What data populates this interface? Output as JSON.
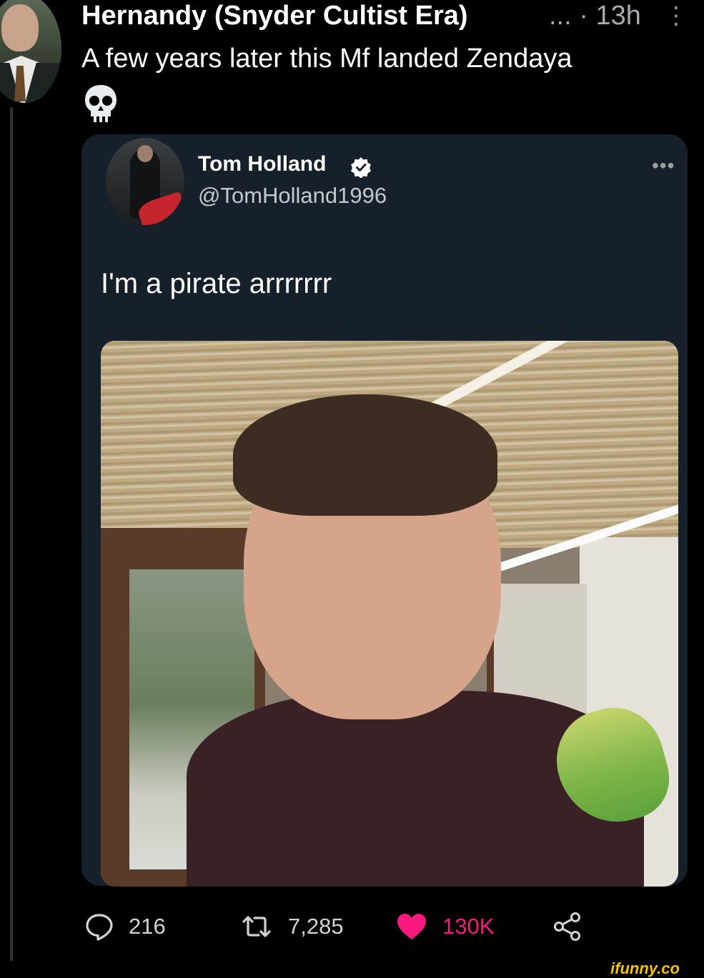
{
  "tweet": {
    "display_name": "Hernandy (Snyder Cultist Era)",
    "meta": "... · 13h",
    "menu_glyph": "⋮",
    "text": "A few years later this Mf landed Zendaya",
    "emoji": "skull-emoji"
  },
  "quoted_tweet": {
    "display_name": "Tom Holland",
    "handle": "@TomHolland1996",
    "verified": true,
    "more_glyph": "•••",
    "text": "I'm a pirate arrrrrrr",
    "media_icon": "photo-of-person-with-parrot"
  },
  "actions": {
    "replies": "216",
    "retweets": "7,285",
    "likes": "130K",
    "like_color": "#f91880"
  },
  "watermark": "ifunny.co",
  "colors": {
    "background": "#000000",
    "card": "#15202b",
    "thread_line": "#2f3336"
  }
}
